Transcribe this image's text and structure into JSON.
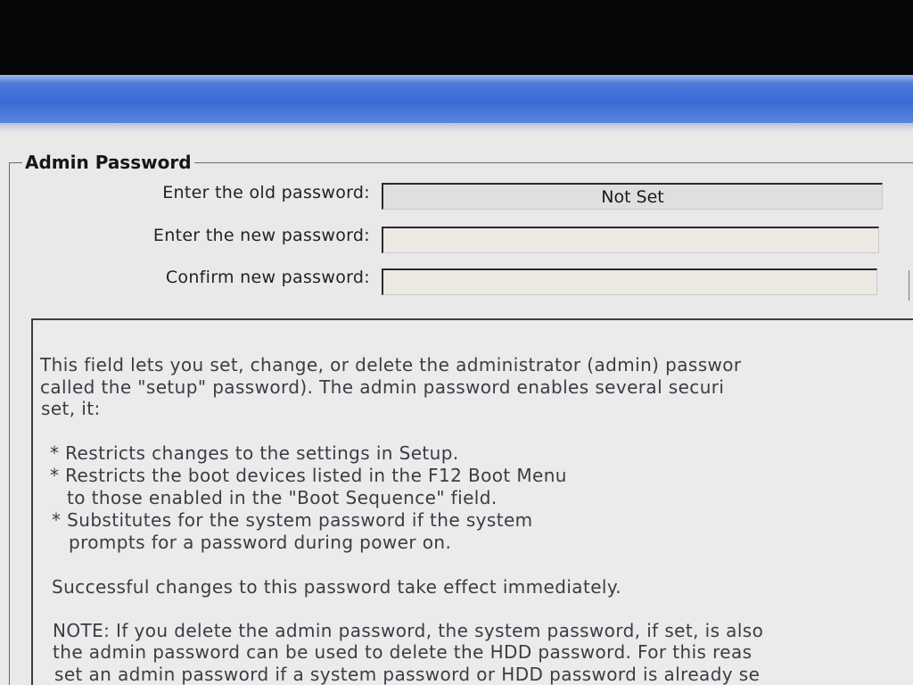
{
  "group": {
    "title": "Admin Password"
  },
  "fields": [
    {
      "label": "Enter the old password:",
      "value": "Not Set"
    },
    {
      "label": "Enter the new password:",
      "value": ""
    },
    {
      "label": "Confirm new password:",
      "value": ""
    }
  ],
  "help": {
    "lines": [
      "This field lets you set, change, or delete the administrator (admin) passwor",
      "called the \"setup\" password).  The admin password enables several securi",
      "set, it:",
      "* Restricts changes to the settings in Setup.",
      "* Restricts the boot devices listed in the F12 Boot Menu",
      "to those enabled in the \"Boot Sequence\" field.",
      "* Substitutes for the system password if the system",
      "prompts for a password during power on.",
      "Successful changes to this password take effect immediately.",
      "NOTE: If you delete the admin password, the system password, if set, is also",
      "the admin password can be used to delete the HDD password.  For this reas",
      "set an admin password if a system password or HDD password is already se"
    ]
  },
  "colors": {
    "title_bar": "#3a6ad6",
    "background": "#e9e9ea",
    "text": "#222222"
  }
}
